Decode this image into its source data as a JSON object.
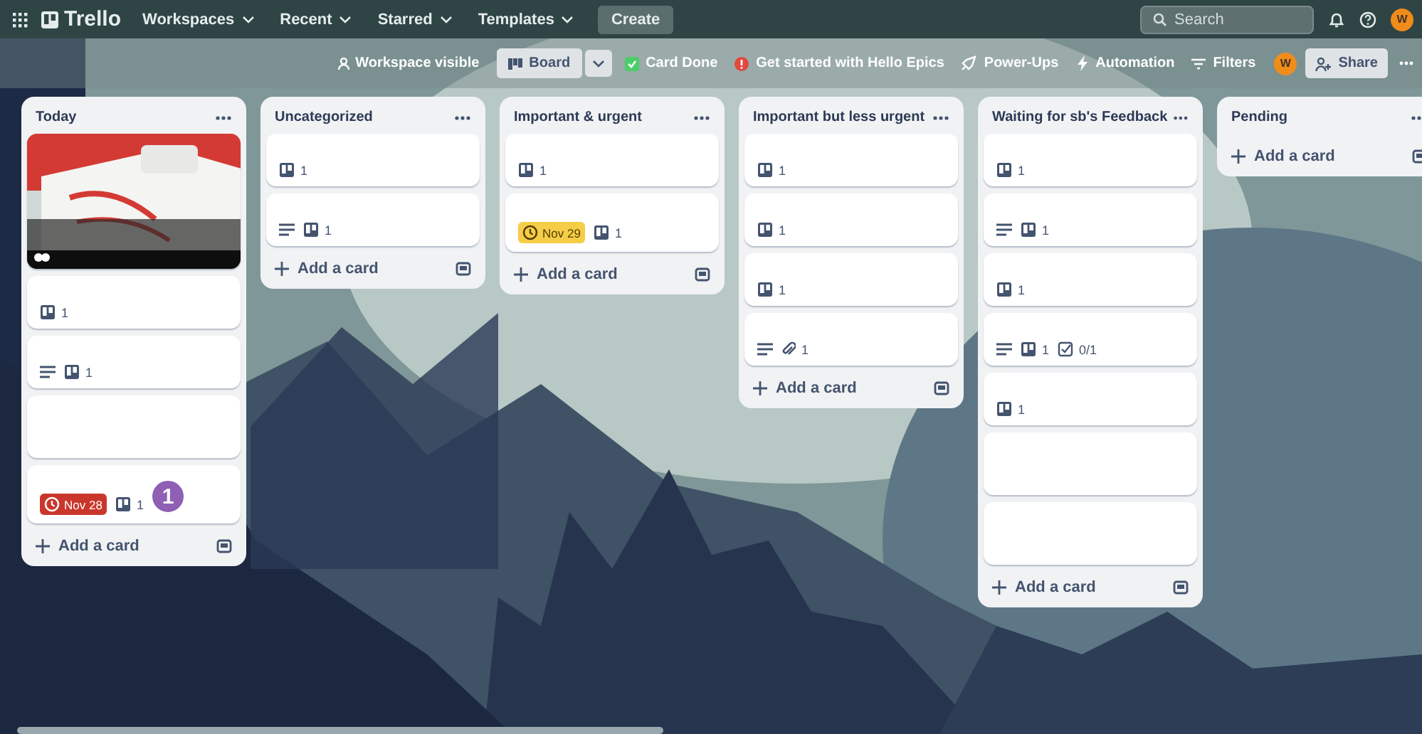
{
  "topbar": {
    "logo": "Trello",
    "menus": [
      {
        "label": "Workspaces"
      },
      {
        "label": "Recent"
      },
      {
        "label": "Starred"
      },
      {
        "label": "Templates"
      }
    ],
    "create": "Create",
    "search": {
      "placeholder": "Search"
    },
    "avatar": "W"
  },
  "board_header": {
    "visibility": "Workspace visible",
    "view": "Board",
    "tools": [
      {
        "kind": "card-done",
        "label": "Card Done"
      },
      {
        "kind": "alert",
        "label": "Get started with Hello Epics"
      },
      {
        "kind": "power-ups",
        "label": "Power-Ups"
      },
      {
        "kind": "automation",
        "label": "Automation"
      },
      {
        "kind": "filters",
        "label": "Filters"
      }
    ],
    "member": "W",
    "share": "Share"
  },
  "lists": [
    {
      "title": "Today",
      "add": "Add a card",
      "cards": [
        {
          "kind": "cover"
        },
        {
          "kind": "plain",
          "badges": [
            {
              "kind": "link",
              "text": "1"
            }
          ]
        },
        {
          "kind": "plain",
          "badges": [
            {
              "kind": "description"
            },
            {
              "kind": "link",
              "text": "1"
            }
          ]
        },
        {
          "kind": "plain"
        },
        {
          "kind": "plain",
          "due": {
            "text": "Nov 28",
            "color": "#c9372c"
          },
          "badges": [
            {
              "kind": "link",
              "text": "1"
            }
          ],
          "callout": "1"
        }
      ]
    },
    {
      "title": "Uncategorized",
      "add": "Add a card",
      "cards": [
        {
          "kind": "plain",
          "badges": [
            {
              "kind": "link",
              "text": "1"
            }
          ]
        },
        {
          "kind": "plain",
          "badges": [
            {
              "kind": "description"
            },
            {
              "kind": "link",
              "text": "1"
            }
          ]
        }
      ]
    },
    {
      "title": "Important & urgent",
      "add": "Add a card",
      "cards": [
        {
          "kind": "plain",
          "badges": [
            {
              "kind": "link",
              "text": "1"
            }
          ]
        },
        {
          "kind": "plain",
          "due": {
            "text": "Nov 29",
            "color": "#f5cd47"
          },
          "badges": [
            {
              "kind": "link",
              "text": "1"
            }
          ]
        }
      ]
    },
    {
      "title": "Important but less urgent",
      "add": "Add a card",
      "cards": [
        {
          "kind": "plain",
          "badges": [
            {
              "kind": "link",
              "text": "1"
            }
          ]
        },
        {
          "kind": "plain",
          "badges": [
            {
              "kind": "link",
              "text": "1"
            }
          ]
        },
        {
          "kind": "plain",
          "badges": [
            {
              "kind": "link",
              "text": "1"
            }
          ]
        },
        {
          "kind": "plain",
          "badges": [
            {
              "kind": "description"
            },
            {
              "kind": "attachment",
              "text": "1"
            }
          ]
        }
      ]
    },
    {
      "title": "Waiting for sb's Feedback",
      "add": "Add a card",
      "cards": [
        {
          "kind": "plain",
          "badges": [
            {
              "kind": "link",
              "text": "1"
            }
          ]
        },
        {
          "kind": "plain",
          "badges": [
            {
              "kind": "description"
            },
            {
              "kind": "link",
              "text": "1"
            }
          ]
        },
        {
          "kind": "plain",
          "badges": [
            {
              "kind": "link",
              "text": "1"
            }
          ]
        },
        {
          "kind": "plain",
          "badges": [
            {
              "kind": "description"
            },
            {
              "kind": "link",
              "text": "1"
            },
            {
              "kind": "checklist",
              "text": "0/1"
            }
          ]
        },
        {
          "kind": "plain",
          "badges": [
            {
              "kind": "link",
              "text": "1"
            }
          ]
        },
        {
          "kind": "plain"
        },
        {
          "kind": "plain"
        }
      ]
    },
    {
      "title": "Pending",
      "add": "Add a card"
    }
  ]
}
